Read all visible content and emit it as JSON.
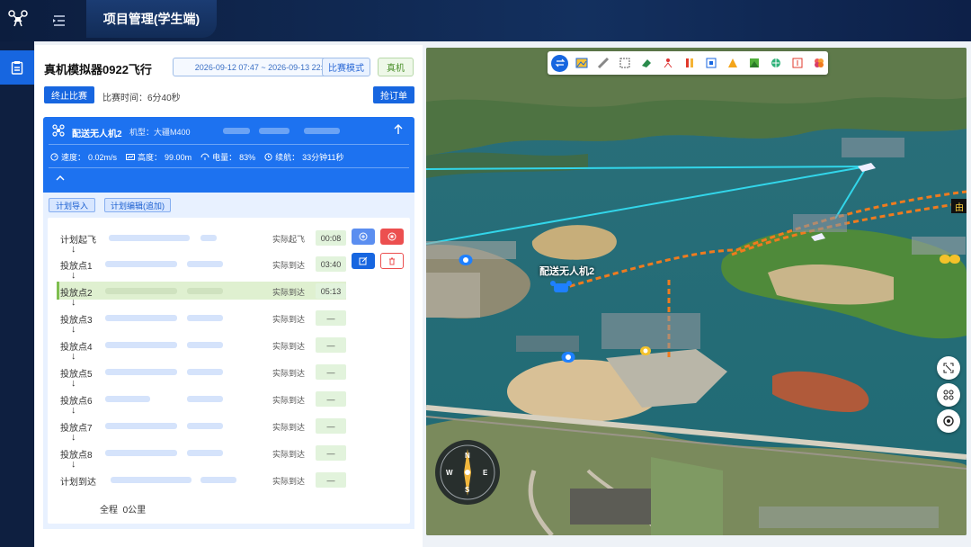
{
  "app": {
    "title": "项目管理(学生端)"
  },
  "project": {
    "name": "真机模拟器0922飞行",
    "date_range": "2026-09-12 07:47 ~ 2026-09-13 22:20",
    "mode": "比赛模式",
    "device_type": "真机",
    "stop_label": "终止比赛",
    "race_time_label": "比赛时间：",
    "race_time_value": "6分40秒",
    "grab_label": "抢订单"
  },
  "drone": {
    "name": "配送无人机2",
    "model_label": "机型：",
    "model": "大疆M400",
    "speed_label": "速度：",
    "speed": "0.02m/s",
    "height_label": "高度：",
    "height": "99.00m",
    "battery_label": "电量：",
    "battery": "83%",
    "endurance_label": "续航：",
    "endurance": "33分钟11秒"
  },
  "plan": {
    "import_label": "计划导入",
    "edit_label": "计划编辑(追加)",
    "rows": [
      {
        "label": "计划起飞",
        "state": "实际起飞",
        "time": "00:08"
      },
      {
        "label": "投放点1",
        "state": "实际到达",
        "time": "03:40"
      },
      {
        "label": "投放点2",
        "state": "实际到达",
        "time": "05:13"
      },
      {
        "label": "投放点3",
        "state": "实际到达",
        "time": "—"
      },
      {
        "label": "投放点4",
        "state": "实际到达",
        "time": "—"
      },
      {
        "label": "投放点5",
        "state": "实际到达",
        "time": "—"
      },
      {
        "label": "投放点6",
        "state": "实际到达",
        "time": "—"
      },
      {
        "label": "投放点7",
        "state": "实际到达",
        "time": "—"
      },
      {
        "label": "投放点8",
        "state": "实际到达",
        "time": "—"
      },
      {
        "label": "计划到达",
        "state": "实际到达",
        "time": "—"
      }
    ],
    "total_label": "全程",
    "total_value": "0公里",
    "arrow": "↓"
  },
  "map": {
    "drone_label": "配送无人机2",
    "edge_tag": "由",
    "compass": {
      "n": "N",
      "s": "S",
      "e": "E",
      "w": "W"
    }
  },
  "colors": {
    "accent": "#1766e0",
    "route_line": "#f07b1e",
    "link_line": "#2fd3e8"
  }
}
